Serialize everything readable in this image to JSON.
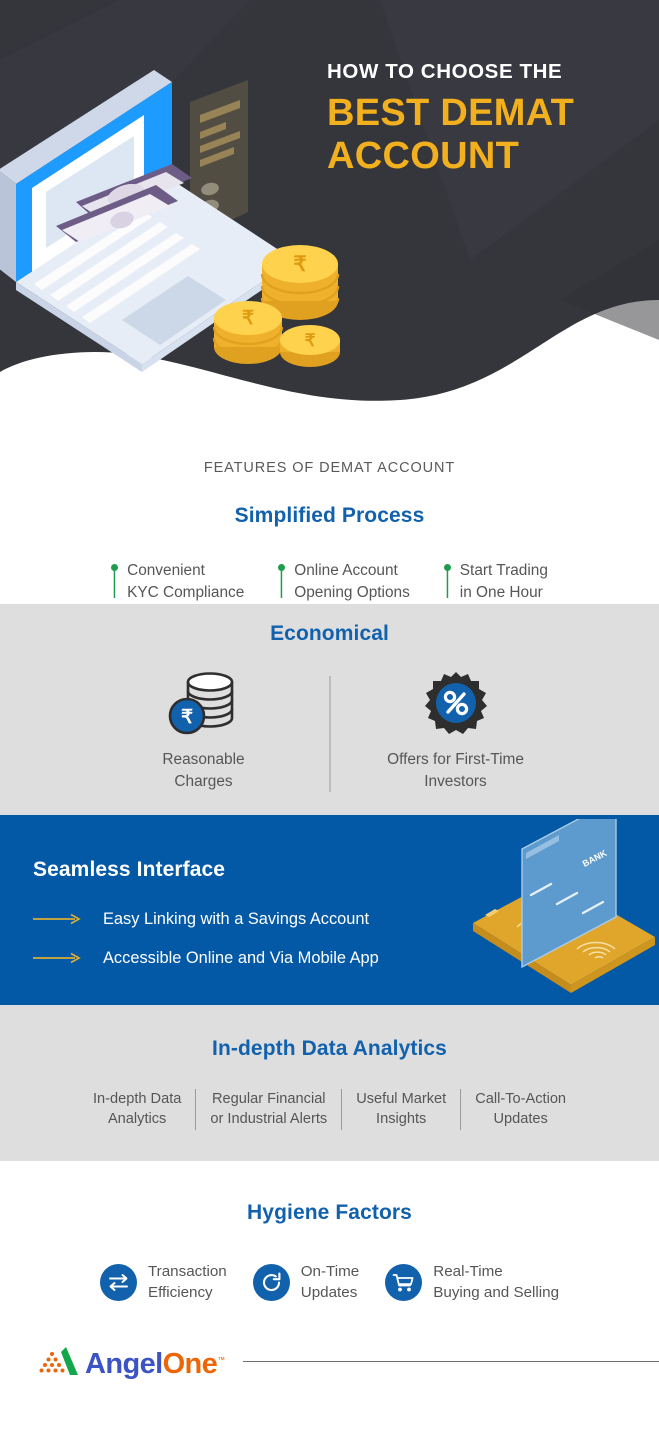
{
  "hero": {
    "kicker": "HOW TO CHOOSE THE",
    "title_line1": "BEST DEMAT",
    "title_line2": "ACCOUNT",
    "bg_color": "#35353c",
    "accent_color": "#f2b01e",
    "illustration": "isometric-laptop-banknotes-document-rupee-coins"
  },
  "features": {
    "label": "FEATURES OF DEMAT ACCOUNT"
  },
  "simplified": {
    "heading": "Simplified Process",
    "items": [
      {
        "line1": "Convenient",
        "line2": "KYC Compliance"
      },
      {
        "line1": "Online Account",
        "line2": "Opening Options"
      },
      {
        "line1": "Start Trading",
        "line2": "in One Hour"
      }
    ],
    "marker_color": "#1f9d4d"
  },
  "economical": {
    "heading": "Economical",
    "items": [
      {
        "line1": "Reasonable",
        "line2": "Charges",
        "icon": "rupee-coin-stack-icon"
      },
      {
        "line1": "Offers for First-Time",
        "line2": "Investors",
        "icon": "percent-badge-icon"
      }
    ]
  },
  "seamless": {
    "heading": "Seamless Interface",
    "items": [
      "Easy Linking with a Savings Account",
      "Accessible Online and Via Mobile App"
    ],
    "bg_color": "#0459a6",
    "arrow_color": "#d9ad33",
    "illustration": "isometric-phone-bank-card-fingerprint",
    "card_label": "BANK"
  },
  "analytics": {
    "heading": "In-depth Data Analytics",
    "items": [
      {
        "line1": "In-depth Data",
        "line2": "Analytics"
      },
      {
        "line1": "Regular Financial",
        "line2": "or Industrial Alerts"
      },
      {
        "line1": "Useful Market",
        "line2": "Insights"
      },
      {
        "line1": "Call-To-Action",
        "line2": "Updates"
      }
    ]
  },
  "hygiene": {
    "heading": "Hygiene Factors",
    "items": [
      {
        "line1": "Transaction",
        "line2": "Efficiency",
        "icon": "exchange-arrows-icon"
      },
      {
        "line1": "On-Time",
        "line2": "Updates",
        "icon": "refresh-clock-icon"
      },
      {
        "line1": "Real-Time",
        "line2": "Buying and Selling",
        "icon": "shopping-cart-icon"
      }
    ],
    "icon_color": "#1161ac"
  },
  "footer": {
    "logo_angel": "Angel",
    "logo_one": "One",
    "logo_tm": "™"
  }
}
